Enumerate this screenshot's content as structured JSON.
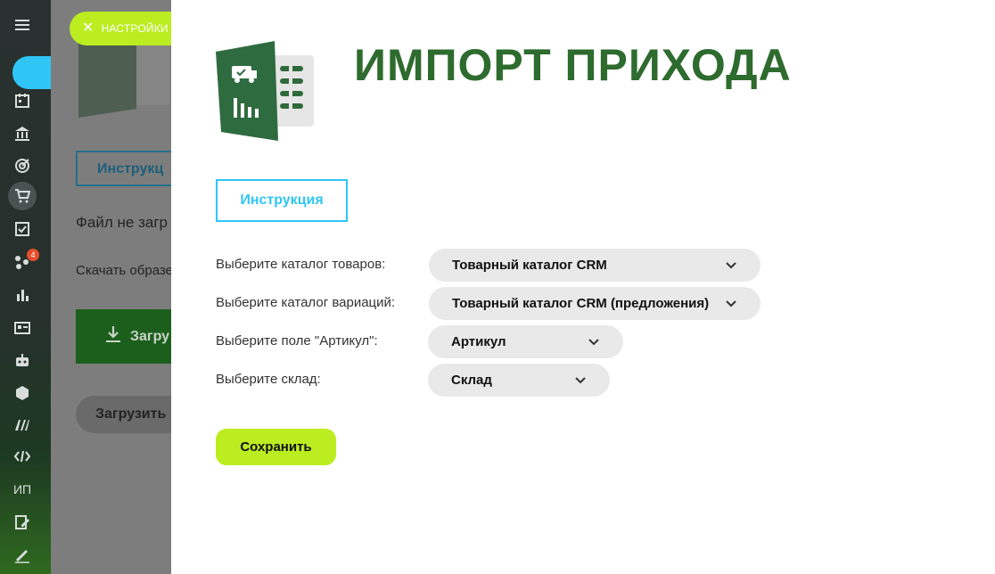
{
  "sidebar": {
    "menu_icon": "hamburger-icon",
    "badge_count": "4",
    "item_ip": "ИП",
    "icons": [
      "calendar-icon",
      "bank-icon",
      "target-icon",
      "cart-icon",
      "checkbox-icon",
      "graph-icon",
      "bar-chart-icon",
      "contact-card-icon",
      "robot-icon",
      "box-icon",
      "logo-m-icon",
      "code-icon",
      "edit-icon",
      "sign-icon"
    ]
  },
  "background_page": {
    "instruction_label": "Инструкц",
    "file_status": "Файл не загр",
    "download_sample": "Скачать образе",
    "upload_label": "Загру",
    "upload2_label": "Загрузить"
  },
  "settings_pill": {
    "label": "НАСТРОЙКИ"
  },
  "panel": {
    "title": "ИМПОРТ ПРИХОДА",
    "instruction_button": "Инструкция",
    "fields": {
      "catalog_label": "Выберите каталог товаров:",
      "catalog_value": "Товарный каталог CRM",
      "variations_label": "Выберите каталог вариаций:",
      "variations_value": "Товарный каталог CRM (предложения)",
      "article_label": "Выберите поле \"Артикул\":",
      "article_value": "Артикул",
      "warehouse_label": "Выберите склад:",
      "warehouse_value": "Склад"
    },
    "save_button": "Сохранить"
  },
  "colors": {
    "accent_green": "#bbed21",
    "title_green": "#2e6b2e",
    "instruction_blue": "#2fc6f6",
    "select_bg": "#e9e9e9"
  }
}
